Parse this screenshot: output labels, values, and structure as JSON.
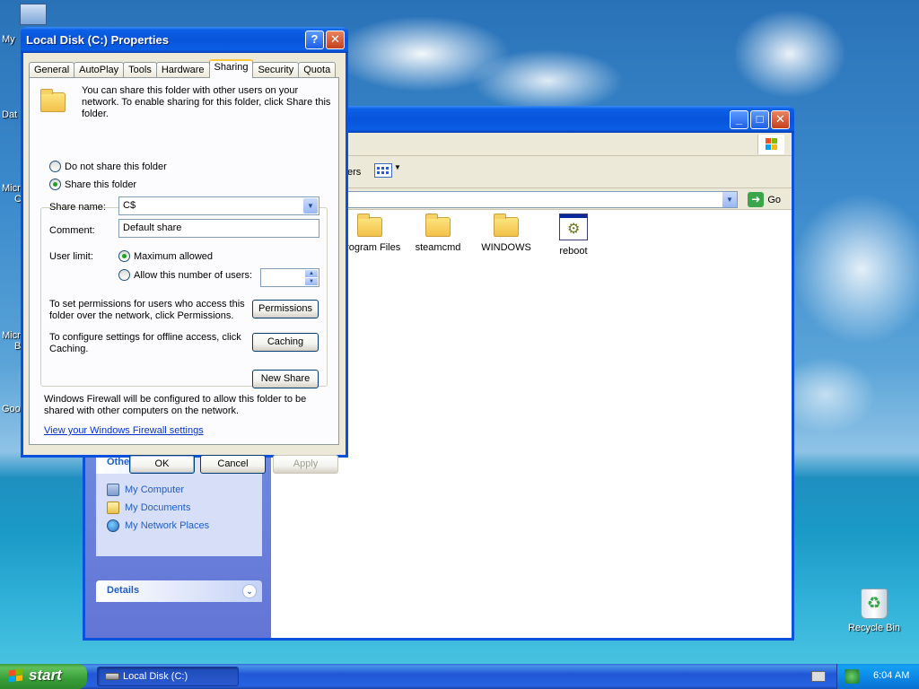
{
  "desktop": {
    "recycle_bin_label": "Recycle Bin",
    "left_labels": [
      "My",
      "Dat",
      "Micr",
      "C",
      "Micr",
      "B",
      "Goo"
    ]
  },
  "explorer": {
    "title": "Local Disk (C:)",
    "toolbar_partial_text": "ers",
    "go_label": "Go",
    "files": [
      {
        "name": "Program Files",
        "type": "folder"
      },
      {
        "name": "steamcmd",
        "type": "folder"
      },
      {
        "name": "WINDOWS",
        "type": "folder"
      },
      {
        "name": "reboot",
        "type": "batch-file"
      }
    ],
    "other_places": {
      "header": "Other Places",
      "items": [
        "My Computer",
        "My Documents",
        "My Network Places"
      ]
    },
    "details": {
      "header": "Details"
    }
  },
  "dialog": {
    "title": "Local Disk (C:) Properties",
    "tabs": [
      "General",
      "AutoPlay",
      "Tools",
      "Hardware",
      "Sharing",
      "Security",
      "Quota"
    ],
    "active_tab": "Sharing",
    "intro": "You can share this folder with other users on your network.  To enable sharing for this folder, click Share this folder.",
    "radio_not_share": "Do not share this folder",
    "radio_share": "Share this folder",
    "share_name_label": "Share name:",
    "share_name_value": "C$",
    "comment_label": "Comment:",
    "comment_value": "Default share",
    "user_limit_label": "User limit:",
    "max_allowed": "Maximum allowed",
    "allow_number": "Allow this number of users:",
    "permissions_text": "To set permissions for users who access this folder over the network, click Permissions.",
    "permissions_button": "Permissions",
    "caching_text": "To configure settings for offline access, click Caching.",
    "caching_button": "Caching",
    "new_share_button": "New Share",
    "firewall_text": "Windows Firewall will be configured to allow this folder to be shared with other computers on the network.",
    "firewall_link": "View your Windows Firewall settings",
    "ok": "OK",
    "cancel": "Cancel",
    "apply": "Apply"
  },
  "taskbar": {
    "start_label": "start",
    "task_button": "Local Disk (C:)",
    "clock": "6:04 AM"
  },
  "colors": {
    "xp_blue_title": "#0a5ee6",
    "task_link_blue": "#215dc6",
    "start_green": "#389e38"
  }
}
